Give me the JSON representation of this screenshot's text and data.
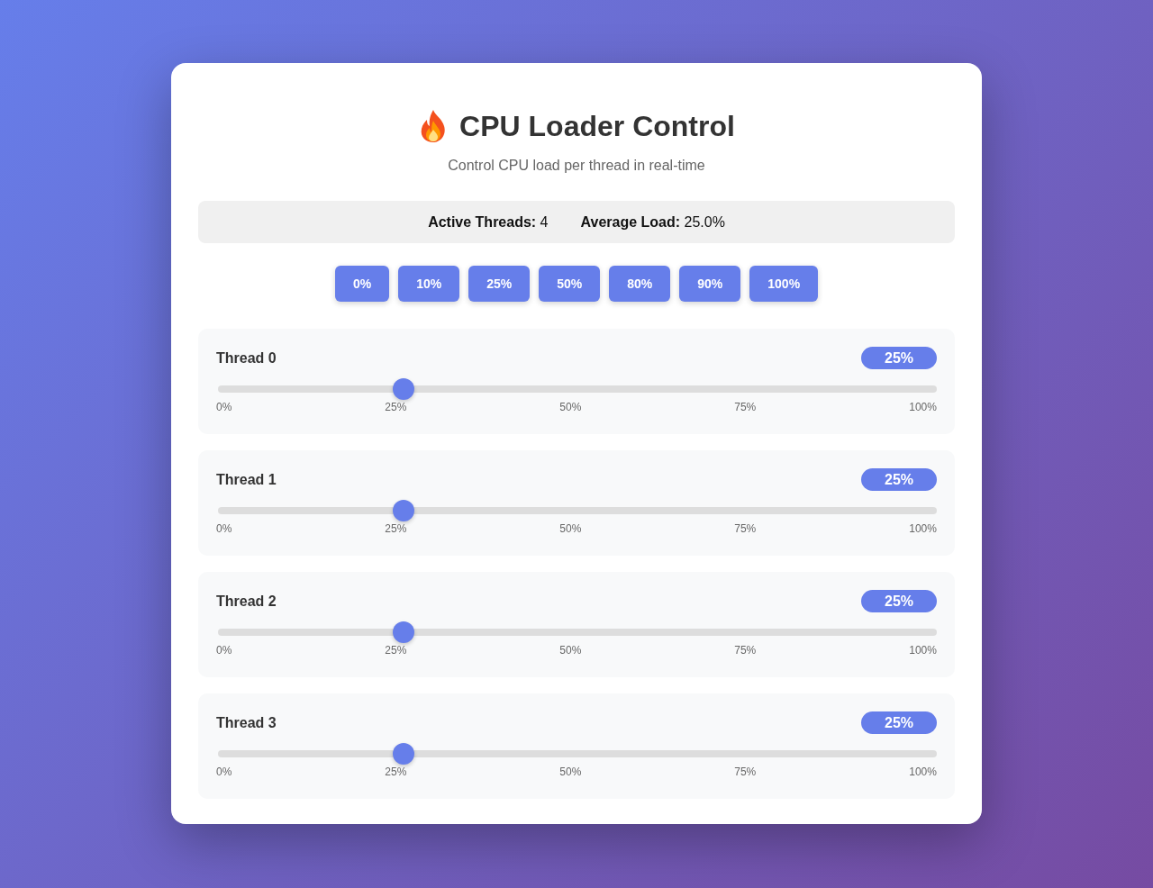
{
  "header": {
    "title": "CPU Loader Control",
    "subtitle": "Control CPU load per thread in real-time"
  },
  "stats": [
    "**Active Threads:** 4",
    "**Average Load:** 25.0%"
  ],
  "presets": [
    "0%",
    "10%",
    "25%",
    "50%",
    "80%",
    "90%",
    "100%"
  ],
  "threads": [
    {
      "name": "Thread 0",
      "reading": "25%",
      "level": 0.25,
      "scale": [
        "0%",
        "25%",
        "50%",
        "75%",
        "100%"
      ]
    },
    {
      "name": "Thread 1",
      "reading": "25%",
      "level": 0.25,
      "scale": [
        "0%",
        "25%",
        "50%",
        "75%",
        "100%"
      ]
    },
    {
      "name": "Thread 2",
      "reading": "25%",
      "level": 0.25,
      "scale": [
        "0%",
        "25%",
        "50%",
        "75%",
        "100%"
      ]
    },
    {
      "name": "Thread 3",
      "reading": "25%",
      "level": 0.25,
      "scale": [
        "0%",
        "25%",
        "50%",
        "75%",
        "100%"
      ]
    }
  ]
}
